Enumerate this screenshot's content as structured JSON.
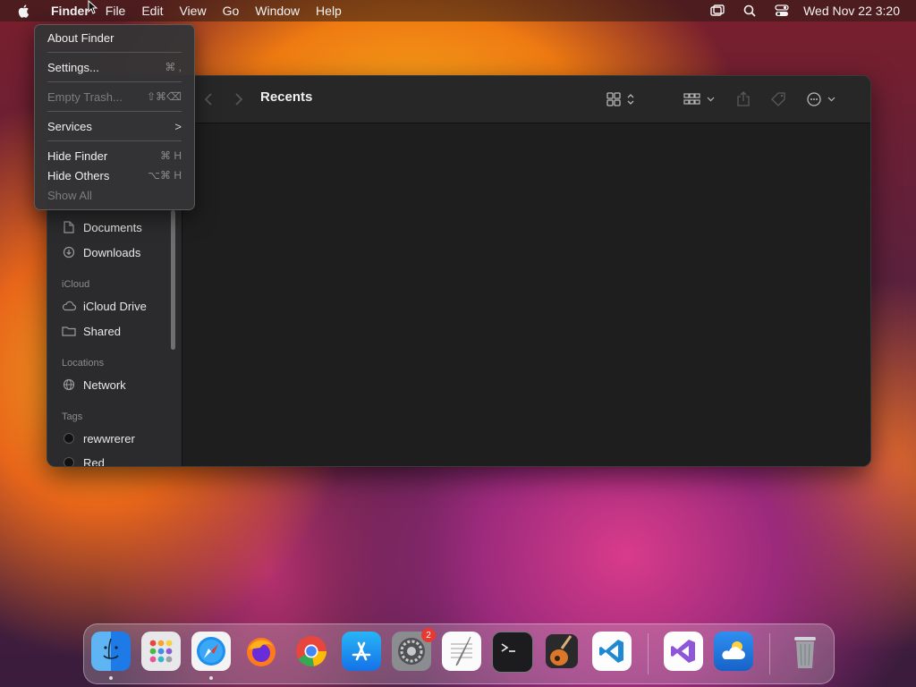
{
  "menubar": {
    "items": [
      "Finder",
      "File",
      "Edit",
      "View",
      "Go",
      "Window",
      "Help"
    ],
    "clock": "Wed Nov 22  3:20"
  },
  "finder_menu": {
    "about": "About Finder",
    "settings": {
      "label": "Settings...",
      "shortcut": "⌘ ,"
    },
    "empty_trash": {
      "label": "Empty Trash...",
      "shortcut": "⇧⌘⌫"
    },
    "services": {
      "label": "Services",
      "arrow": ">"
    },
    "hide_finder": {
      "label": "Hide Finder",
      "shortcut": "⌘ H"
    },
    "hide_others": {
      "label": "Hide Others",
      "shortcut": "⌥⌘ H"
    },
    "show_all": "Show All"
  },
  "window": {
    "title": "Recents"
  },
  "sidebar": {
    "items_top": [
      {
        "label": "Documents",
        "icon": "document-icon"
      },
      {
        "label": "Downloads",
        "icon": "download-icon"
      }
    ],
    "icloud_header": "iCloud",
    "icloud_items": [
      {
        "label": "iCloud Drive",
        "icon": "cloud-icon"
      },
      {
        "label": "Shared",
        "icon": "shared-folder-icon"
      }
    ],
    "locations_header": "Locations",
    "location_items": [
      {
        "label": "Network",
        "icon": "globe-icon"
      }
    ],
    "tags_header": "Tags",
    "tag_items": [
      {
        "label": "rewwrerer",
        "color": "#111111"
      },
      {
        "label": "Red",
        "color": "#111111"
      }
    ]
  },
  "dock": {
    "apps": [
      "Finder",
      "Launchpad",
      "Safari",
      "Firefox",
      "Chrome",
      "App Store",
      "System Settings",
      "TextEdit",
      "Terminal",
      "GarageBand",
      "Visual Studio Code",
      "Visual Studio",
      "Weather",
      "Trash"
    ],
    "system_settings_badge": "2"
  }
}
